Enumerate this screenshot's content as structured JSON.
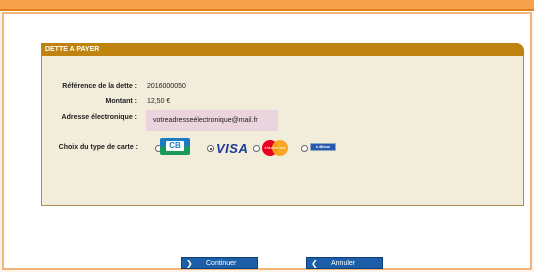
{
  "panel": {
    "title": "DETTE A PAYER"
  },
  "fields": {
    "reference_label": "Référence de la dette :",
    "reference_value": "2016000050",
    "amount_label": "Montant :",
    "amount_value": "12,50 €",
    "email_label": "Adresse électronique :",
    "email_value": "votreadresseélectronique@mail.fr",
    "card_type_label": "Choix du type de carte :"
  },
  "cards": {
    "cb": "CB",
    "visa": "VISA",
    "mastercard": "MasterCard",
    "eblue": "e-Bleue",
    "selected": "visa"
  },
  "actions": {
    "continue_label": "Continuer",
    "cancel_label": "Annuler"
  },
  "colors": {
    "panel_header": "#bf8410",
    "panel_bg": "#f2ecdb",
    "email_bg": "#ecd4de",
    "button_bg": "#1c5fa8",
    "frame_border": "#f4b57a",
    "top_bar": "#f6a24b"
  }
}
